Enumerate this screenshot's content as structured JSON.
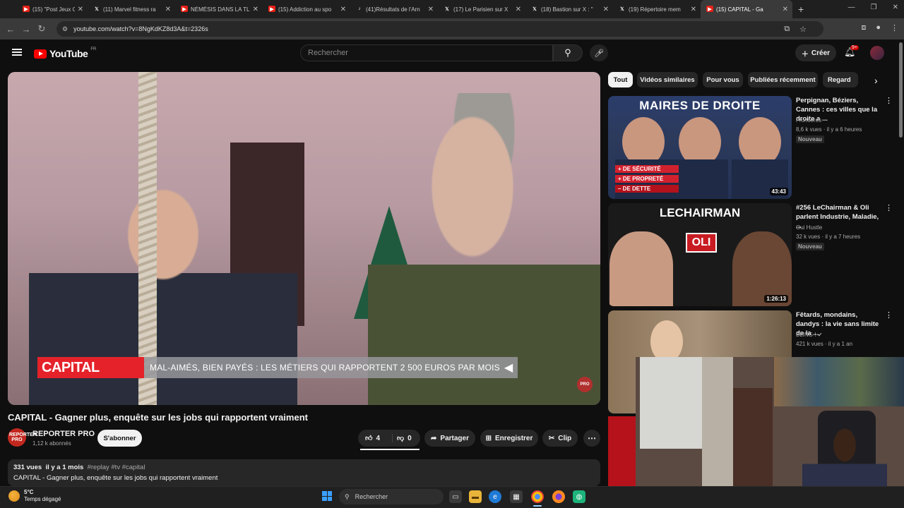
{
  "browser": {
    "tabs": [
      {
        "title": "(15) \"Post Jeux Olympi",
        "icon": "youtube-icon"
      },
      {
        "title": "(11) Marvel fitness ra",
        "icon": "x-icon"
      },
      {
        "title": "NÉMÉSIS DANS LA TL",
        "icon": "youtube-icon"
      },
      {
        "title": "(15) Addiction au spo",
        "icon": "youtube-icon"
      },
      {
        "title": "(41)Résultats de l'Arn",
        "icon": "tiktok-icon"
      },
      {
        "title": "(17) Le Parisien sur X",
        "icon": "x-icon"
      },
      {
        "title": "(18) Bastion sur X : \"",
        "icon": "x-icon"
      },
      {
        "title": "(19) Répertoire mem",
        "icon": "x-icon"
      },
      {
        "title": "(15) CAPITAL - Ga",
        "icon": "youtube-icon"
      }
    ],
    "url": "youtube.com/watch?v=8NgKdKZ8d3A&t=2326s"
  },
  "youtube": {
    "logo_text": "YouTube",
    "country": "FR",
    "search_placeholder": "Rechercher",
    "create_label": "Créer",
    "notif_count": "9+"
  },
  "video": {
    "ticker_brand": "CAPITAL",
    "ticker_text": "MAL-AIMÉS, BIEN PAYÉS : LES MÉTIERS QUI RAPPORTENT 2 500 EUROS PAR MOIS",
    "watermark": "PRO",
    "title": "CAPITAL - Gagner plus, enquête sur les jobs qui rapportent vraiment",
    "channel": "REPORTER PRO",
    "channel_avatar_text": "REPORTER PRO",
    "subscribers": "1,12 k abonnés",
    "subscribe_label": "S'abonner",
    "likes": "4",
    "dislikes": "0",
    "share_label": "Partager",
    "save_label": "Enregistrer",
    "clip_label": "Clip",
    "views": "331 vues",
    "age": "il y a 1 mois",
    "tags": "#replay #tv #capital",
    "description": "CAPITAL - Gagner plus, enquête sur les jobs qui rapportent vraiment"
  },
  "chips": [
    "Tout",
    "Vidéos similaires",
    "Pour vous",
    "Publiées récemment",
    "Regard"
  ],
  "recommendations": [
    {
      "title": "Perpignan, Béziers, Cannes : ces villes que la droite a ...",
      "channel": "Frontières",
      "meta": "8,6 k vues · il y a 6 heures",
      "badge": "Nouveau",
      "duration": "43:43",
      "thumb_head": "MAIRES DE DROITE",
      "thumb_labels": [
        "+ DE SÉCURITÉ",
        "+ DE PROPRETÉ",
        "– DE DETTE"
      ]
    },
    {
      "title": "#256 LeChairman & Oli parlent Industrie, Maladie, ...",
      "channel": "Oui Hustle",
      "meta": "32 k vues · il y a 7 heures",
      "badge": "Nouveau",
      "duration": "1:26:13",
      "thumb_head": "LECHAIRMAN",
      "thumb_label": "OLI"
    },
    {
      "title": "Fêtards, mondains, dandys : la vie sans limite de la ...",
      "channel": "BLING !",
      "meta": "421 k vues · il y a 1 an",
      "badge": "",
      "duration": ""
    }
  ],
  "taskbar": {
    "temperature": "5°C",
    "weather": "Temps dégagé",
    "search_label": "Rechercher"
  }
}
